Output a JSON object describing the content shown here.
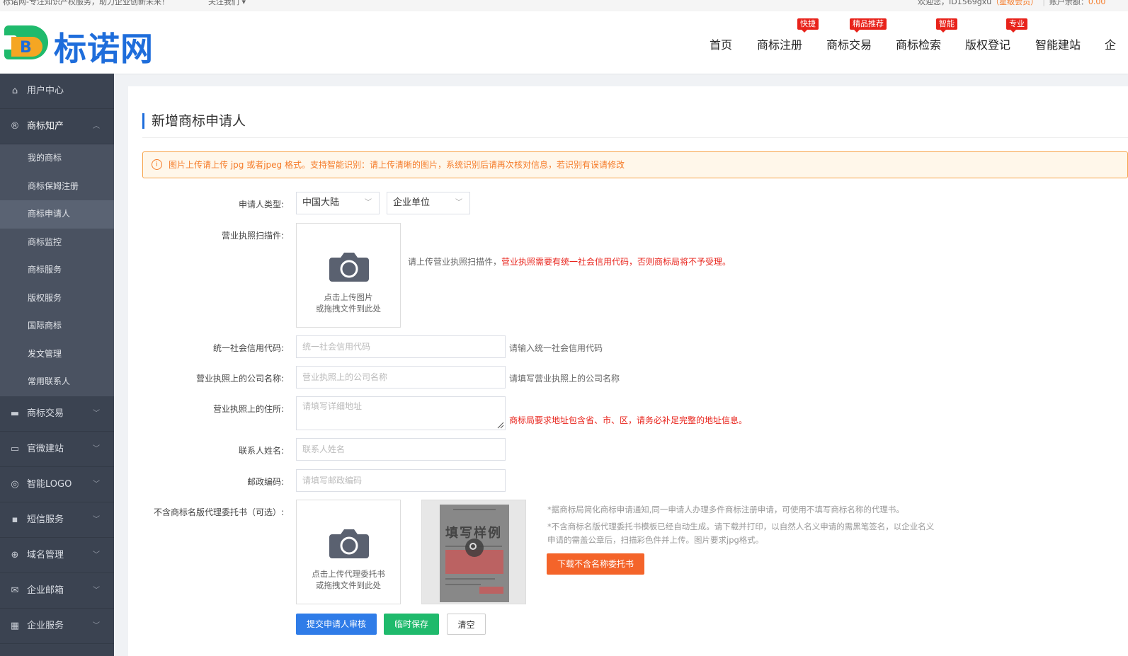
{
  "topbar": {
    "slogan": "标诺网-专注知识产权服务，助力企业创新未来！",
    "contact": "关注我们 ▾",
    "welcome": "欢迎您，ID1569gxu",
    "vip": "（星级会员）",
    "balance_label": "账户余额：",
    "balance_value": "0.00"
  },
  "logo": {
    "mark": "B",
    "name": "标诺网"
  },
  "nav": {
    "items": [
      {
        "label": "首页",
        "badge": ""
      },
      {
        "label": "商标注册",
        "badge": "快捷"
      },
      {
        "label": "商标交易",
        "badge": "精品推荐"
      },
      {
        "label": "商标检索",
        "badge": "智能"
      },
      {
        "label": "版权登记",
        "badge": "专业"
      },
      {
        "label": "智能建站",
        "badge": ""
      },
      {
        "label": "企",
        "badge": ""
      }
    ]
  },
  "sidebar": {
    "user_center": "用户中心",
    "trademark": "商标知产",
    "sub": [
      "我的商标",
      "商标保姆注册",
      "商标申请人",
      "商标监控",
      "商标服务",
      "版权服务",
      "国际商标",
      "发文管理",
      "常用联系人"
    ],
    "groups": [
      "商标交易",
      "官微建站",
      "智能LOGO",
      "短信服务",
      "域名管理",
      "企业邮箱",
      "企业服务"
    ]
  },
  "page": {
    "title": "新增商标申请人",
    "notice": "图片上传请上传 jpg 或者jpeg 格式。支持智能识别：请上传清晰的图片，系统识别后请再次核对信息，若识别有误请修改"
  },
  "form": {
    "type_label": "申请人类型:",
    "region_value": "中国大陆",
    "entity_value": "企业单位",
    "license_label": "营业执照扫描件:",
    "license_upload_line1": "点击上传图片",
    "license_upload_line2": "或拖拽文件到此处",
    "license_hint_plain": "请上传营业执照扫描件，",
    "license_hint_red": "营业执照需要有统一社会信用代码，否则商标局将不予受理。",
    "credit_label": "统一社会信用代码:",
    "credit_placeholder": "统一社会信用代码",
    "credit_hint": "请输入统一社会信用代码",
    "company_label": "营业执照上的公司名称:",
    "company_placeholder": "营业执照上的公司名称",
    "company_hint": "请填写营业执照上的公司名称",
    "address_label": "营业执照上的住所:",
    "address_placeholder": "请填写详细地址",
    "address_hint": "商标局要求地址包含省、市、区，请务必补足完整的地址信息。",
    "contact_label": "联系人姓名:",
    "contact_placeholder": "联系人姓名",
    "postal_label": "邮政编码:",
    "postal_placeholder": "请填写邮政编码",
    "proxy_label": "不含商标名版代理委托书（可选）:",
    "proxy_upload_line1": "点击上传代理委托书",
    "proxy_upload_line2": "或拖拽文件到此处",
    "sample_watermark": "填写样例",
    "note1": "*据商标局简化商标申请通知,同一申请人办理多件商标注册申请，可使用不填写商标名称的代理书。",
    "note2": "*不含商标名版代理委托书模板已经自动生成。请下载并打印，以自然人名义申请的需黑笔签名，以企业名义",
    "note3": "申请的需盖公章后，扫描彩色件并上传。图片要求jpg格式。",
    "download_btn": "下载不含名称委托书",
    "submit_btn": "提交申请人审核",
    "save_btn": "临时保存",
    "clear_btn": "清空"
  },
  "colors": {
    "brand": "#1e6ddb",
    "accent": "#f57c2a",
    "danger": "#e8231b",
    "sidebar": "#3b4351"
  }
}
